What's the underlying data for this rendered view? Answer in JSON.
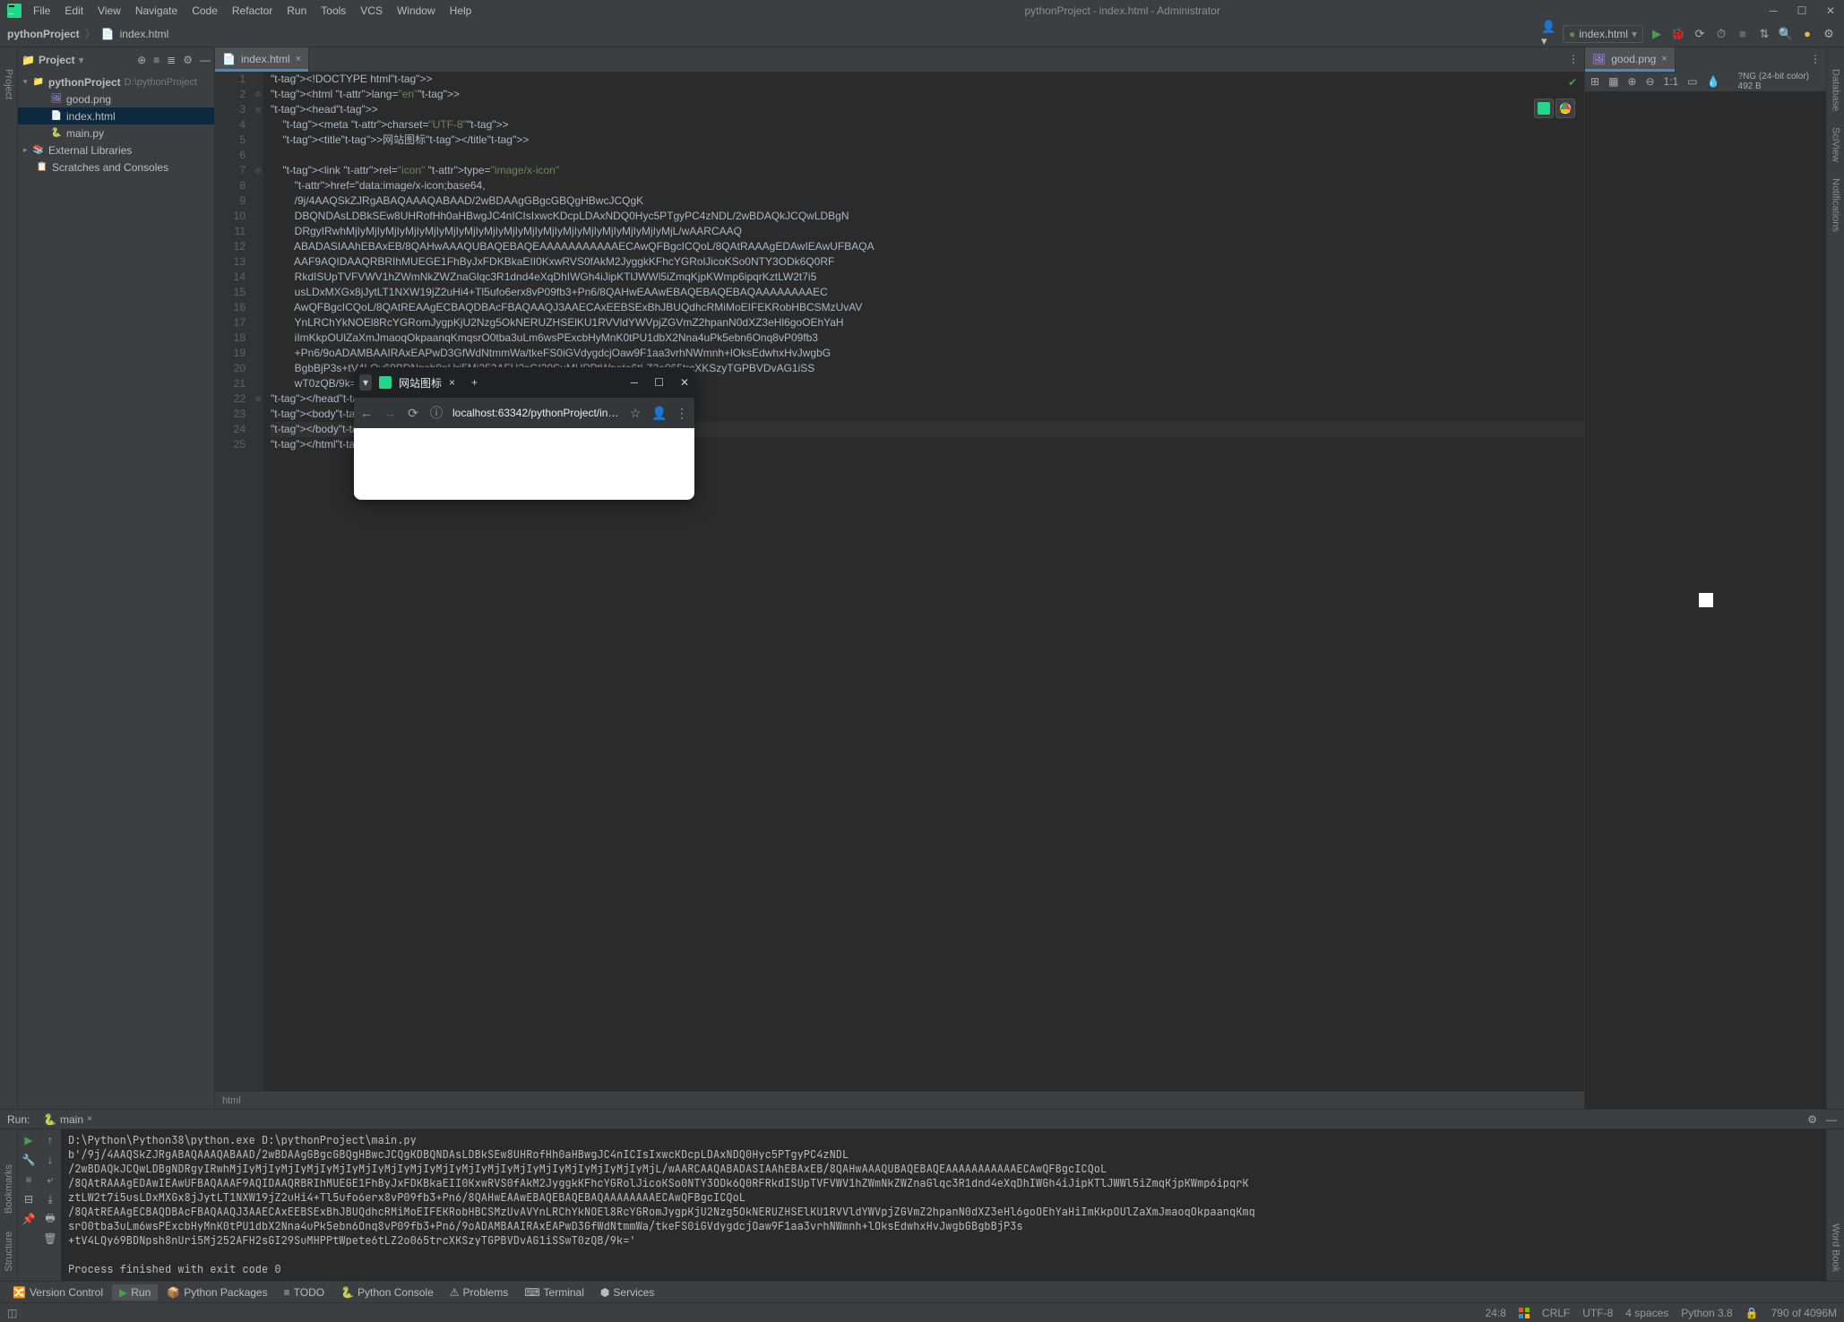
{
  "title": {
    "project": "pythonProject",
    "file": "index.html",
    "admin": "Administrator"
  },
  "menu": [
    "File",
    "Edit",
    "View",
    "Navigate",
    "Code",
    "Refactor",
    "Run",
    "Tools",
    "VCS",
    "Window",
    "Help"
  ],
  "breadcrumbs": {
    "root": "pythonProject",
    "file": "index.html"
  },
  "runconfig": "index.html",
  "project": {
    "label": "Project"
  },
  "tree": {
    "root": "pythonProject",
    "rootpath": "D:\\pythonProject",
    "children": [
      "good.png",
      "index.html",
      "main.py"
    ],
    "ext": "External Libraries",
    "scratch": "Scratches and Consoles"
  },
  "tab": {
    "name": "index.html"
  },
  "imgTab": {
    "name": "good.png"
  },
  "imgInfo": {
    "zoom": "1:1",
    "meta": "?NG (24-bit color) 492 B"
  },
  "code": {
    "lines": [
      "<!DOCTYPE html>",
      "<html lang=\"en\">",
      "<head>",
      "    <meta charset=\"UTF-8\">",
      "    <title>网站图标</title>",
      "",
      "    <link rel=\"icon\" type=\"image/x-icon\"",
      "        href=\"data:image/x-icon;base64,",
      "        /9j/4AAQSkZJRgABAQAAAQABAAD/2wBDAAgGBgcGBQgHBwcJCQgK",
      "        DBQNDAsLDBkSEw8UHRofHh0aHBwgJC4nICIsIxwcKDcpLDAxNDQ0Hyc5PTgyPC4zNDL/2wBDAQkJCQwLDBgN",
      "        DRgyIRwhMjIyMjIyMjIyMjIyMjIyMjIyMjIyMjIyMjIyMjIyMjIyMjIyMjIyMjIyMjIyMjIyMjL/wAARCAAQ",
      "        ABADASIAAhEBAxEB/8QAHwAAAQUBAQEBAQEAAAAAAAAAAAECAwQFBgcICQoL/8QAtRAAAgEDAwIEAwUFBAQA",
      "        AAF9AQIDAAQRBRIhMUEGE1FhByJxFDKBkaEII0KxwRVS0fAkM2JyggkKFhcYGRolJicoKSo0NTY3ODk6Q0RF",
      "        RkdISUpTVFVWV1hZWmNkZWZnaGlqc3R1dnd4eXqDhIWGh4iJipKTlJWWl5iZmqKjpKWmp6ipqrKztLW2t7i5",
      "        usLDxMXGx8jJytLT1NXW19jZ2uHi4+Tl5ufo6erx8vP09fb3+Pn6/8QAHwEAAwEBAQEBAQEBAQAAAAAAAAEC",
      "        AwQFBgcICQoL/8QAtREAAgECBAQDBAcFBAQAAQJ3AAECAxEEBSExBhJBUQdhcRMiMoEIFEKRobHBCSMzUvAV",
      "        YnLRChYkNOEl8RcYGRomJygpKjU2Nzg5OkNERUZHSElKU1RVVldYWVpjZGVmZ2hpanN0dXZ3eHl6goOEhYaH",
      "        iImKkpOUlZaXmJmaoqOkpaanqKmqsrO0tba3uLm6wsPExcbHyMnK0tPU1dbX2Nna4uPk5ebn6Onq8vP09fb3",
      "        +Pn6/9oADAMBAAIRAxEAPwD3GfWdNtmmWa/tkeFS0iGVdygdcjOaw9F1aa3vrhNWmnh+lOksEdwhxHvJwgbG",
      "        BgbBjP3s+tV4LQy69BDNpsh8nUri5Mj252AFH2sGI29SuMHPPtWpete6tLZ2o065trcXKSzyTGPBVDvAG1iSS",
      "        wT0zQB/9k=\">",
      "</head>",
      "<body>",
      "</body>",
      "</html>"
    ]
  },
  "crumb": "html",
  "run": {
    "label": "Run:",
    "name": "main",
    "lines": [
      "D:\\Python\\Python38\\python.exe D:\\pythonProject\\main.py",
      "b'/9j/4AAQSkZJRgABAQAAAQABAAD/2wBDAAgGBgcGBQgHBwcJCQgKDBQNDAsLDBkSEw8UHRofHh0aHBwgJC4nICIsIxwcKDcpLDAxNDQ0Hyc5PTgyPC4zNDL",
      "/2wBDAQkJCQwLDBgNDRgyIRwhMjIyMjIyMjIyMjIyMjIyMjIyMjIyMjIyMjIyMjIyMjIyMjIyMjIyMjIyMjIyMjIyMjL/wAARCAAQABADASIAAhEBAxEB/8QAHwAAAQUBAQEBAQEAAAAAAAAAAAECAwQFBgcICQoL",
      "/8QAtRAAAgEDAwIEAwUFBAQAAAF9AQIDAAQRBRIhMUEGE1FhByJxFDKBkaEII0KxwRVS0fAkM2JyggkKFhcYGRolJicoKSo0NTY3ODk6Q0RFRkdISUpTVFVWV1hZWmNkZWZnaGlqc3R1dnd4eXqDhIWGh4iJipKTlJWWl5iZmqKjpKWmp6ipqrK",
      "ztLW2t7i5usLDxMXGx8jJytLT1NXW19jZ2uHi4+Tl5ufo6erx8vP09fb3+Pn6/8QAHwEAAwEBAQEBAQEBAQAAAAAAAAECAwQFBgcICQoL",
      "/8QAtREAAgECBAQDBAcFBAQAAQJ3AAECAxEEBSExBhJBUQdhcRMiMoEIFEKRobHBCSMzUvAVYnLRChYkNOEl8RcYGRomJygpKjU2Nzg5OkNERUZHSElKU1RVVldYWVpjZGVmZ2hpanN0dXZ3eHl6goOEhYaHiImKkpOUlZaXmJmaoqOkpaanqKmq",
      "srO0tba3uLm6wsPExcbHyMnK0tPU1dbX2Nna4uPk5ebn6Onq8vP09fb3+Pn6/9oADAMBAAIRAxEAPwD3GfWdNtmmWa/tkeFS0iGVdygdcjOaw9F1aa3vrhNWmnh+lOksEdwhxHvJwgbGBgbBjP3s",
      "+tV4LQy69BDNpsh8nUri5Mj252AFH2sGI29SuMHPPtWpete6tLZ2o065trcXKSzyTGPBVDvAG1iSSwT0zQB/9k='",
      "",
      "Process finished with exit code 0"
    ]
  },
  "bottom": [
    "Version Control",
    "Run",
    "Python Packages",
    "TODO",
    "Python Console",
    "Problems",
    "Terminal",
    "Services"
  ],
  "status": {
    "pos": "24:8",
    "crlf": "CRLF",
    "enc": "UTF-8",
    "indent": "4 spaces",
    "sdk": "Python 3.8",
    "mem": "790 of 4096M"
  },
  "side": {
    "project": "Project",
    "bookmarks": "Bookmarks",
    "structure": "Structure",
    "sciview": "SciView",
    "notif": "Notifications",
    "db": "Database",
    "wordbook": "Word Book"
  },
  "browser": {
    "title": "网站图标",
    "url": "localhost:63342/pythonProject/index.html?..."
  }
}
